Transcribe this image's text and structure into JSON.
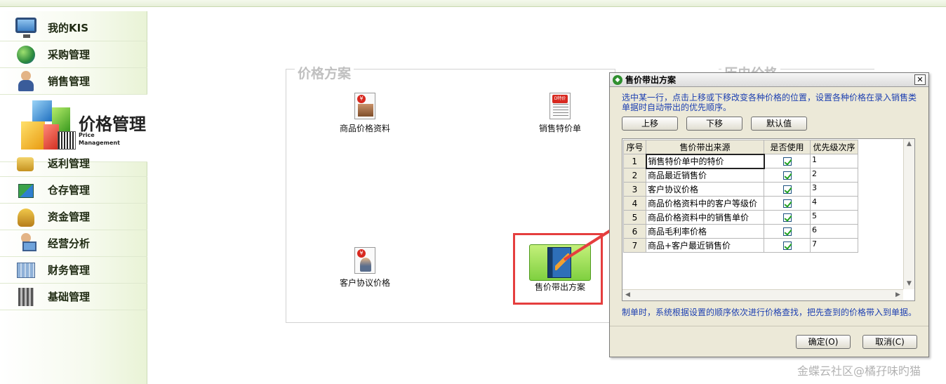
{
  "sidebar": {
    "items": [
      {
        "label": "我的KIS",
        "icon": "monitor-icon"
      },
      {
        "label": "采购管理",
        "icon": "globe-icon"
      },
      {
        "label": "销售管理",
        "icon": "person-box-icon"
      },
      {
        "label": "返利管理",
        "icon": "coins-icon"
      },
      {
        "label": "仓存管理",
        "icon": "cube-icon"
      },
      {
        "label": "资金管理",
        "icon": "money-bag-icon"
      },
      {
        "label": "经营分析",
        "icon": "analysis-icon"
      },
      {
        "label": "财务管理",
        "icon": "ledger-icon"
      },
      {
        "label": "基础管理",
        "icon": "tools-icon"
      }
    ],
    "active": {
      "label": "价格管理",
      "sub_line1": "Price",
      "sub_line2": "Management"
    }
  },
  "panel": {
    "title": "价格方案",
    "second_title": "历史价格",
    "tiles": {
      "product_price": "商品价格资料",
      "sales_special": "销售特价单",
      "customer_price": "客户协议价格",
      "price_scheme": "售价带出方案"
    },
    "badge_text": "¥",
    "badge_text2": "D特价"
  },
  "dialog": {
    "title": "售价带出方案",
    "close": "✕",
    "description": "选中某一行，点击上移或下移改变各种价格的位置，设置各种价格在录入销售类单据时自动带出的优先顺序。",
    "buttons": {
      "up": "上移",
      "down": "下移",
      "default": "默认值",
      "ok": "确定(O)",
      "cancel": "取消(C)"
    },
    "columns": {
      "seq": "序号",
      "source": "售价带出来源",
      "use": "是否使用",
      "priority": "优先级次序"
    },
    "rows": [
      {
        "seq": "1",
        "source": "销售特价单中的特价",
        "priority": "1"
      },
      {
        "seq": "2",
        "source": "商品最近销售价",
        "priority": "2"
      },
      {
        "seq": "3",
        "source": "客户协议价格",
        "priority": "3"
      },
      {
        "seq": "4",
        "source": "商品价格资料中的客户等级价",
        "priority": "4"
      },
      {
        "seq": "5",
        "source": "商品价格资料中的销售单价",
        "priority": "5"
      },
      {
        "seq": "6",
        "source": "商品毛利率价格",
        "priority": "6"
      },
      {
        "seq": "7",
        "source": "商品+客户最近销售价",
        "priority": "7"
      }
    ],
    "footer": "制单时，系统根据设置的顺序依次进行价格查找，把先查到的价格带入到单据。"
  },
  "watermark": "金蝶云社区@橘孖味旳猫",
  "colors": {
    "highlight": "#e53e3e",
    "dialog_text": "#1c3fb1",
    "sidebar_bg": "#e9f3d6"
  }
}
